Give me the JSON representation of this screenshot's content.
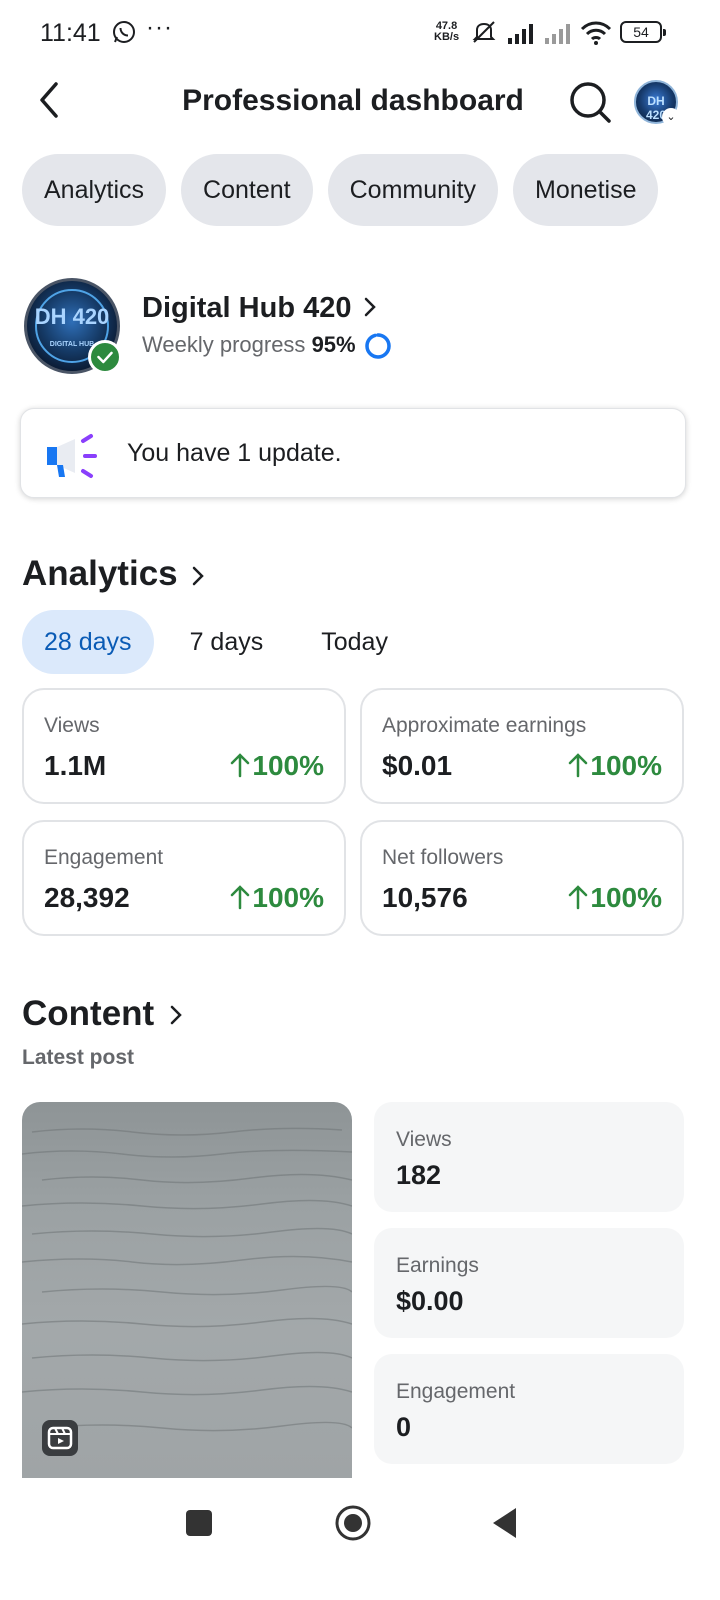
{
  "status_bar": {
    "time": "11:41",
    "dots": "···",
    "speed_value": "47.8",
    "speed_unit": "KB/s",
    "battery": "54",
    "icons": [
      "whatsapp-icon",
      "mute-icon",
      "signal-icon",
      "signal-weak-icon",
      "wifi-icon",
      "battery-icon"
    ]
  },
  "header": {
    "title": "Professional dashboard",
    "back_icon": "back-arrow-icon",
    "search_icon": "search-icon"
  },
  "tabs": [
    {
      "label": "Analytics"
    },
    {
      "label": "Content"
    },
    {
      "label": "Community"
    },
    {
      "label": "Monetise"
    }
  ],
  "profile": {
    "name": "Digital Hub 420",
    "progress_label": "Weekly progress",
    "progress_value": "95%",
    "progress_fraction": 0.95,
    "avatar_text": "DH 420",
    "avatar_subtext": "DIGITAL HUB"
  },
  "update": {
    "text": "You have 1 update."
  },
  "analytics": {
    "title": "Analytics",
    "periods": [
      {
        "label": "28 days",
        "active": true
      },
      {
        "label": "7 days",
        "active": false
      },
      {
        "label": "Today",
        "active": false
      }
    ],
    "metrics": [
      {
        "label": "Views",
        "value": "1.1M",
        "change": "100%"
      },
      {
        "label": "Approximate earnings",
        "value": "$0.01",
        "change": "100%"
      },
      {
        "label": "Engagement",
        "value": "28,392",
        "change": "100%"
      },
      {
        "label": "Net followers",
        "value": "10,576",
        "change": "100%"
      }
    ]
  },
  "content": {
    "title": "Content",
    "latest_label": "Latest post",
    "stats": [
      {
        "label": "Views",
        "value": "182"
      },
      {
        "label": "Earnings",
        "value": "$0.00"
      },
      {
        "label": "Engagement",
        "value": "0"
      }
    ]
  },
  "colors": {
    "accent_blue": "#0a5bb5",
    "positive_green": "#2d8a3e",
    "chip_bg": "#e4e6eb",
    "active_tab_bg": "#dbe9fb"
  }
}
